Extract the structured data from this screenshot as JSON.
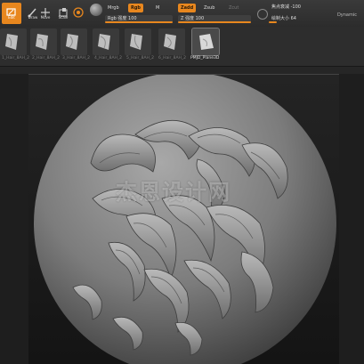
{
  "toolbar": {
    "buttons": [
      {
        "name": "edit-button",
        "label": "Edit",
        "icon": "edit-icon",
        "active": true
      },
      {
        "name": "draw-button",
        "label": "Draw",
        "icon": "brush-icon",
        "active": false
      },
      {
        "name": "move-button",
        "label": "Move",
        "icon": "move-icon",
        "active": false
      },
      {
        "name": "scale-button",
        "label": "Scale",
        "icon": "scale-icon",
        "active": false
      },
      {
        "name": "rotate-button",
        "label": "Rotate",
        "icon": "rotate-icon",
        "active": false
      }
    ],
    "modes": {
      "mrgb": "Mrgb",
      "rgb": "Rgb",
      "m": "M",
      "zadd": "Zadd",
      "zsub": "Zsub",
      "zcut": "Zcut"
    },
    "rgb_intensity": {
      "label": "Rgb 强度",
      "value": "100",
      "fraction": 1.0
    },
    "z_intensity": {
      "label": "Z 强度",
      "value": "100",
      "fraction": 1.0
    },
    "focal_shift": {
      "label": "焦点衰减",
      "value": "-100",
      "fraction": 0.0
    },
    "draw_size": {
      "label": "绘制大小",
      "value": "64",
      "fraction": 0.15
    },
    "dynamic_label": "Dynamic",
    "accent": "#e8871e"
  },
  "shelf": {
    "brushes": [
      {
        "label": "1_Hair_8AH_2"
      },
      {
        "label": "2_Hair_8AH_2"
      },
      {
        "label": "3_Hair_8AH_2"
      },
      {
        "label": "4_Hair_8AH_2"
      },
      {
        "label": "5_Hair_8AH_2"
      },
      {
        "label": "6_Hair_8AH_2"
      },
      {
        "label": "PMJD_Plane3D",
        "selected": true
      }
    ]
  },
  "viewport": {
    "watermark": "杰恩设计网",
    "subject": "sculpted-sphere-with-hair-strands"
  }
}
